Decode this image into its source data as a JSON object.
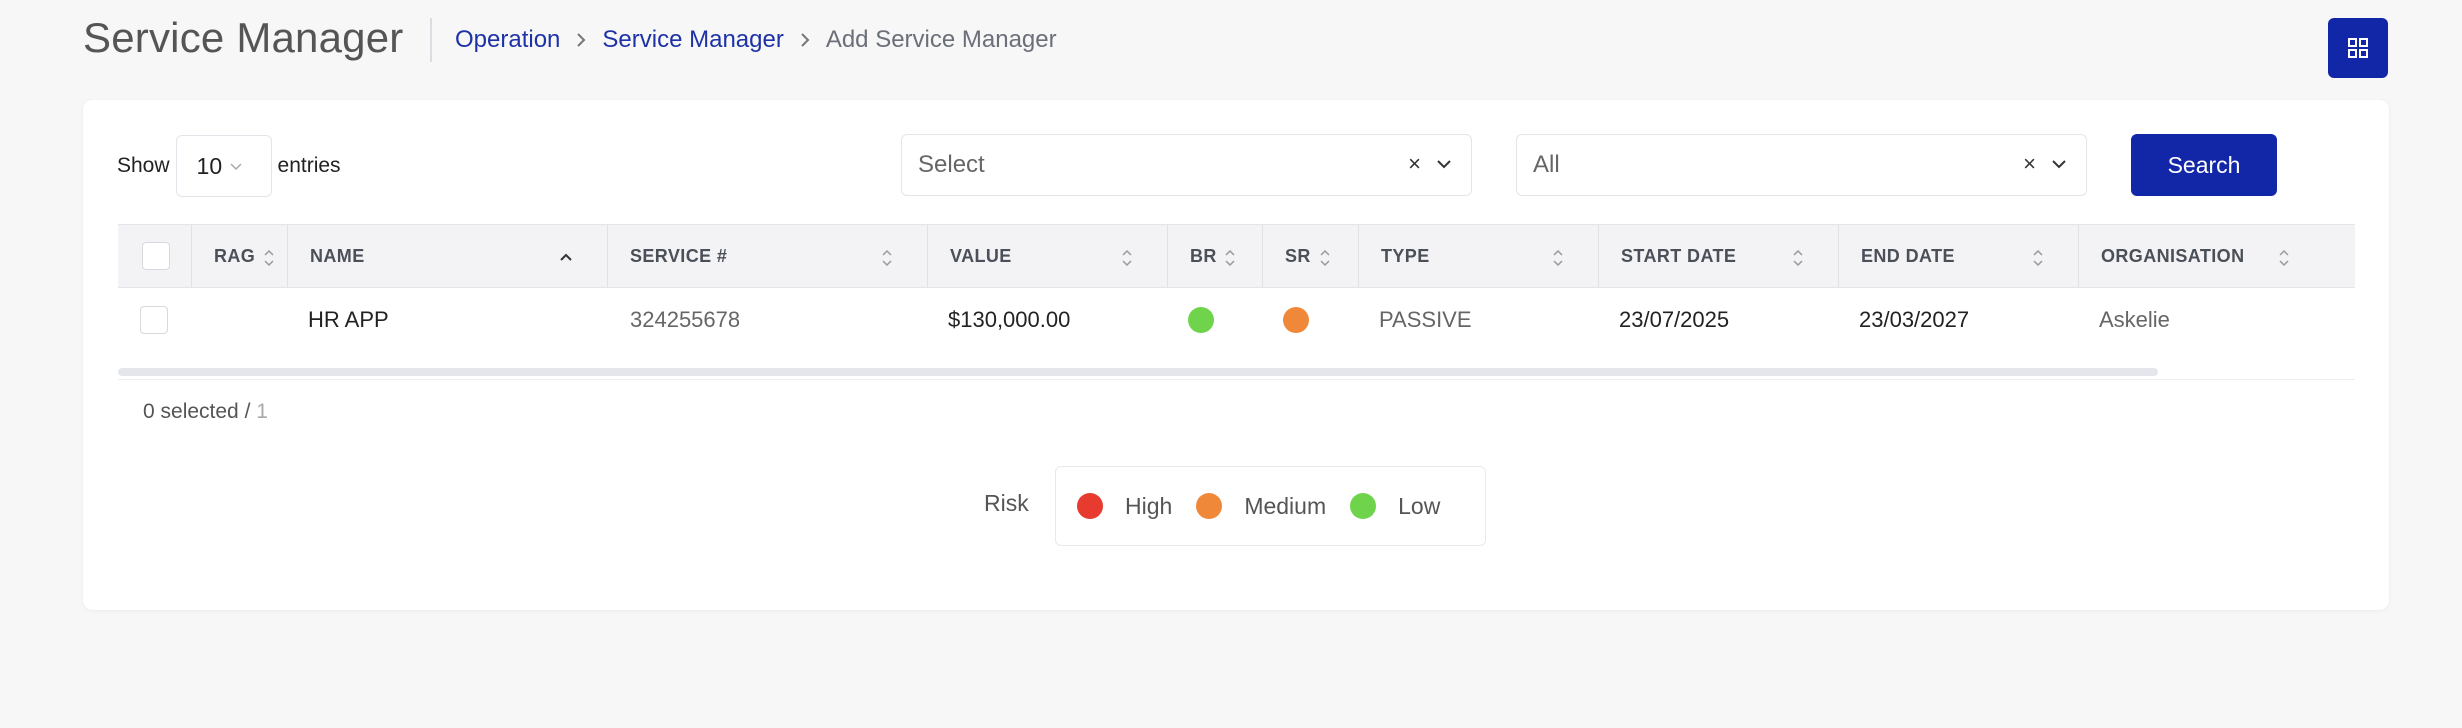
{
  "header": {
    "title": "Service Manager",
    "breadcrumb": [
      "Operation",
      "Service Manager",
      "Add Service Manager"
    ]
  },
  "toolbar": {
    "show_label": "Show",
    "entries_value": "10",
    "entries_label": "entries",
    "filter1_value": "Select",
    "filter2_value": "All",
    "search_label": "Search"
  },
  "table": {
    "columns": [
      "RAG",
      "NAME",
      "SERVICE #",
      "VALUE",
      "BR",
      "SR",
      "TYPE",
      "START DATE",
      "END DATE",
      "ORGANISATION"
    ],
    "rows": [
      {
        "rag": "",
        "name": "HR APP",
        "service_no": "324255678",
        "value": "$130,000.00",
        "br": "Low",
        "sr": "Medium",
        "type": "PASSIVE",
        "start_date": "23/07/2025",
        "end_date": "23/03/2027",
        "organisation": "Askelie"
      }
    ]
  },
  "selection": {
    "prefix": "0 selected / ",
    "total": "1"
  },
  "risk_legend": {
    "label": "Risk",
    "items": [
      {
        "label": "High",
        "color": "#e63b2e"
      },
      {
        "label": "Medium",
        "color": "#f0883a"
      },
      {
        "label": "Low",
        "color": "#6fd44c"
      }
    ]
  },
  "colors": {
    "primary": "#1227a8",
    "link": "#1e32a6"
  }
}
